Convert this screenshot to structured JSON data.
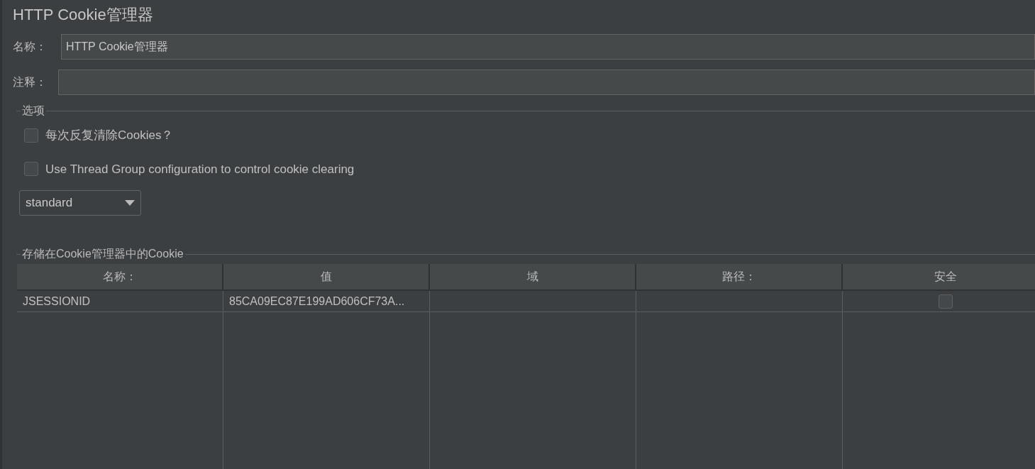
{
  "title": "HTTP Cookie管理器",
  "name_field": {
    "label": "名称：",
    "value": "HTTP Cookie管理器"
  },
  "comment_field": {
    "label": "注释："
  },
  "options": {
    "legend": "选项",
    "checkboxes": [
      {
        "label": "每次反复清除Cookies？",
        "checked": false
      },
      {
        "label": "Use Thread Group configuration to control cookie clearing",
        "checked": false
      }
    ],
    "policy_select": {
      "value": "standard"
    }
  },
  "cookies": {
    "legend": "存储在Cookie管理器中的Cookie",
    "columns": [
      "名称：",
      "值",
      "域",
      "路径：",
      "安全"
    ],
    "rows": [
      {
        "name": "JSESSIONID",
        "value": "85CA09EC87E199AD606CF73A...",
        "secure": false
      }
    ]
  }
}
